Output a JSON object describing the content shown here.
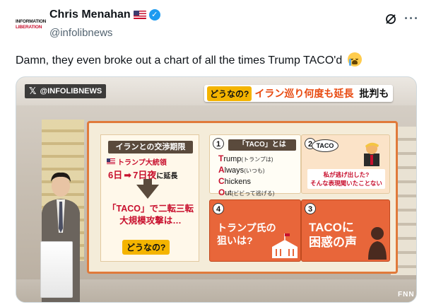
{
  "post": {
    "author_name": "Chris Menahan",
    "author_handle": "@infolibnews",
    "logo_line1": "INFORMATION",
    "logo_line2": "LIBERATION",
    "text": "Damn, they even broke out a chart of all the times Trump TACO'd",
    "icons": [
      "us-flag-icon",
      "verified-badge-icon",
      "grok-icon",
      "more-options-icon",
      "loudly-crying-face-emoji"
    ],
    "verified_color": "#1d9bf0"
  },
  "video": {
    "watermark_x": "𝕏",
    "watermark": "@INFOLIBNEWS",
    "headline_tag": "どうなの?",
    "headline_main": "イラン巡り何度も延長",
    "headline_sub": "批判も",
    "left_panel": {
      "title": "イランとの交渉期限",
      "president_label": "トランプ大統領",
      "date_from": "6日",
      "date_to": "7日夜",
      "date_suffix": "に延長",
      "attack_line1": "「TACO」で二転三転",
      "attack_line2": "大規模攻撃は…",
      "tag": "どうなの?"
    },
    "card1": {
      "number": "1",
      "title": "「TACO」とは",
      "lines": [
        {
          "initial": "T",
          "rest": "rump",
          "note": "(トランプは)"
        },
        {
          "initial": "A",
          "rest": "lways",
          "note": "(いつも)"
        },
        {
          "initial": "C",
          "rest": "hickens",
          "note": ""
        },
        {
          "initial": "O",
          "rest": "ut",
          "note": "(ビビって逃げる)"
        }
      ]
    },
    "card2": {
      "number": "2",
      "bubble": "TACO",
      "quote_line1": "私が逃げ出した?",
      "quote_line2": "そんな表現聞いたことない"
    },
    "card3": {
      "number": "4",
      "text_line1": "トランプ氏の",
      "text_line2": "狙いは?"
    },
    "card4": {
      "number": "3",
      "text_line1": "TACOに",
      "text_line2": "困惑の声"
    },
    "corner_logo": "FNN",
    "accent_color": "#e8663a",
    "headline_color": "#e8490f"
  }
}
